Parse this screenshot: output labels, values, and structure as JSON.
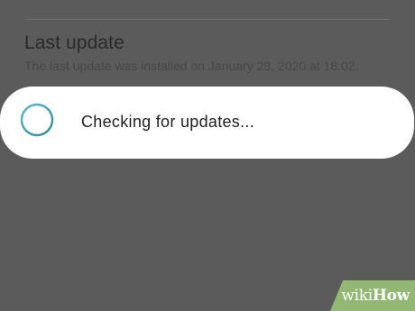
{
  "settings": {
    "title": "Last update",
    "description": "The last update was installed on January 28, 2020 at 18:02."
  },
  "dialog": {
    "message": "Checking for updates...",
    "spinner_icon": "progress-ring-icon",
    "spinner_colors": [
      "#4aa9c6",
      "#2b8a96"
    ]
  },
  "watermark": {
    "prefix": "wiki",
    "suffix": "How",
    "color": "#93b874"
  },
  "colors": {
    "dimmed_background": "#5b5b5b",
    "dialog_background": "#ffffff"
  }
}
